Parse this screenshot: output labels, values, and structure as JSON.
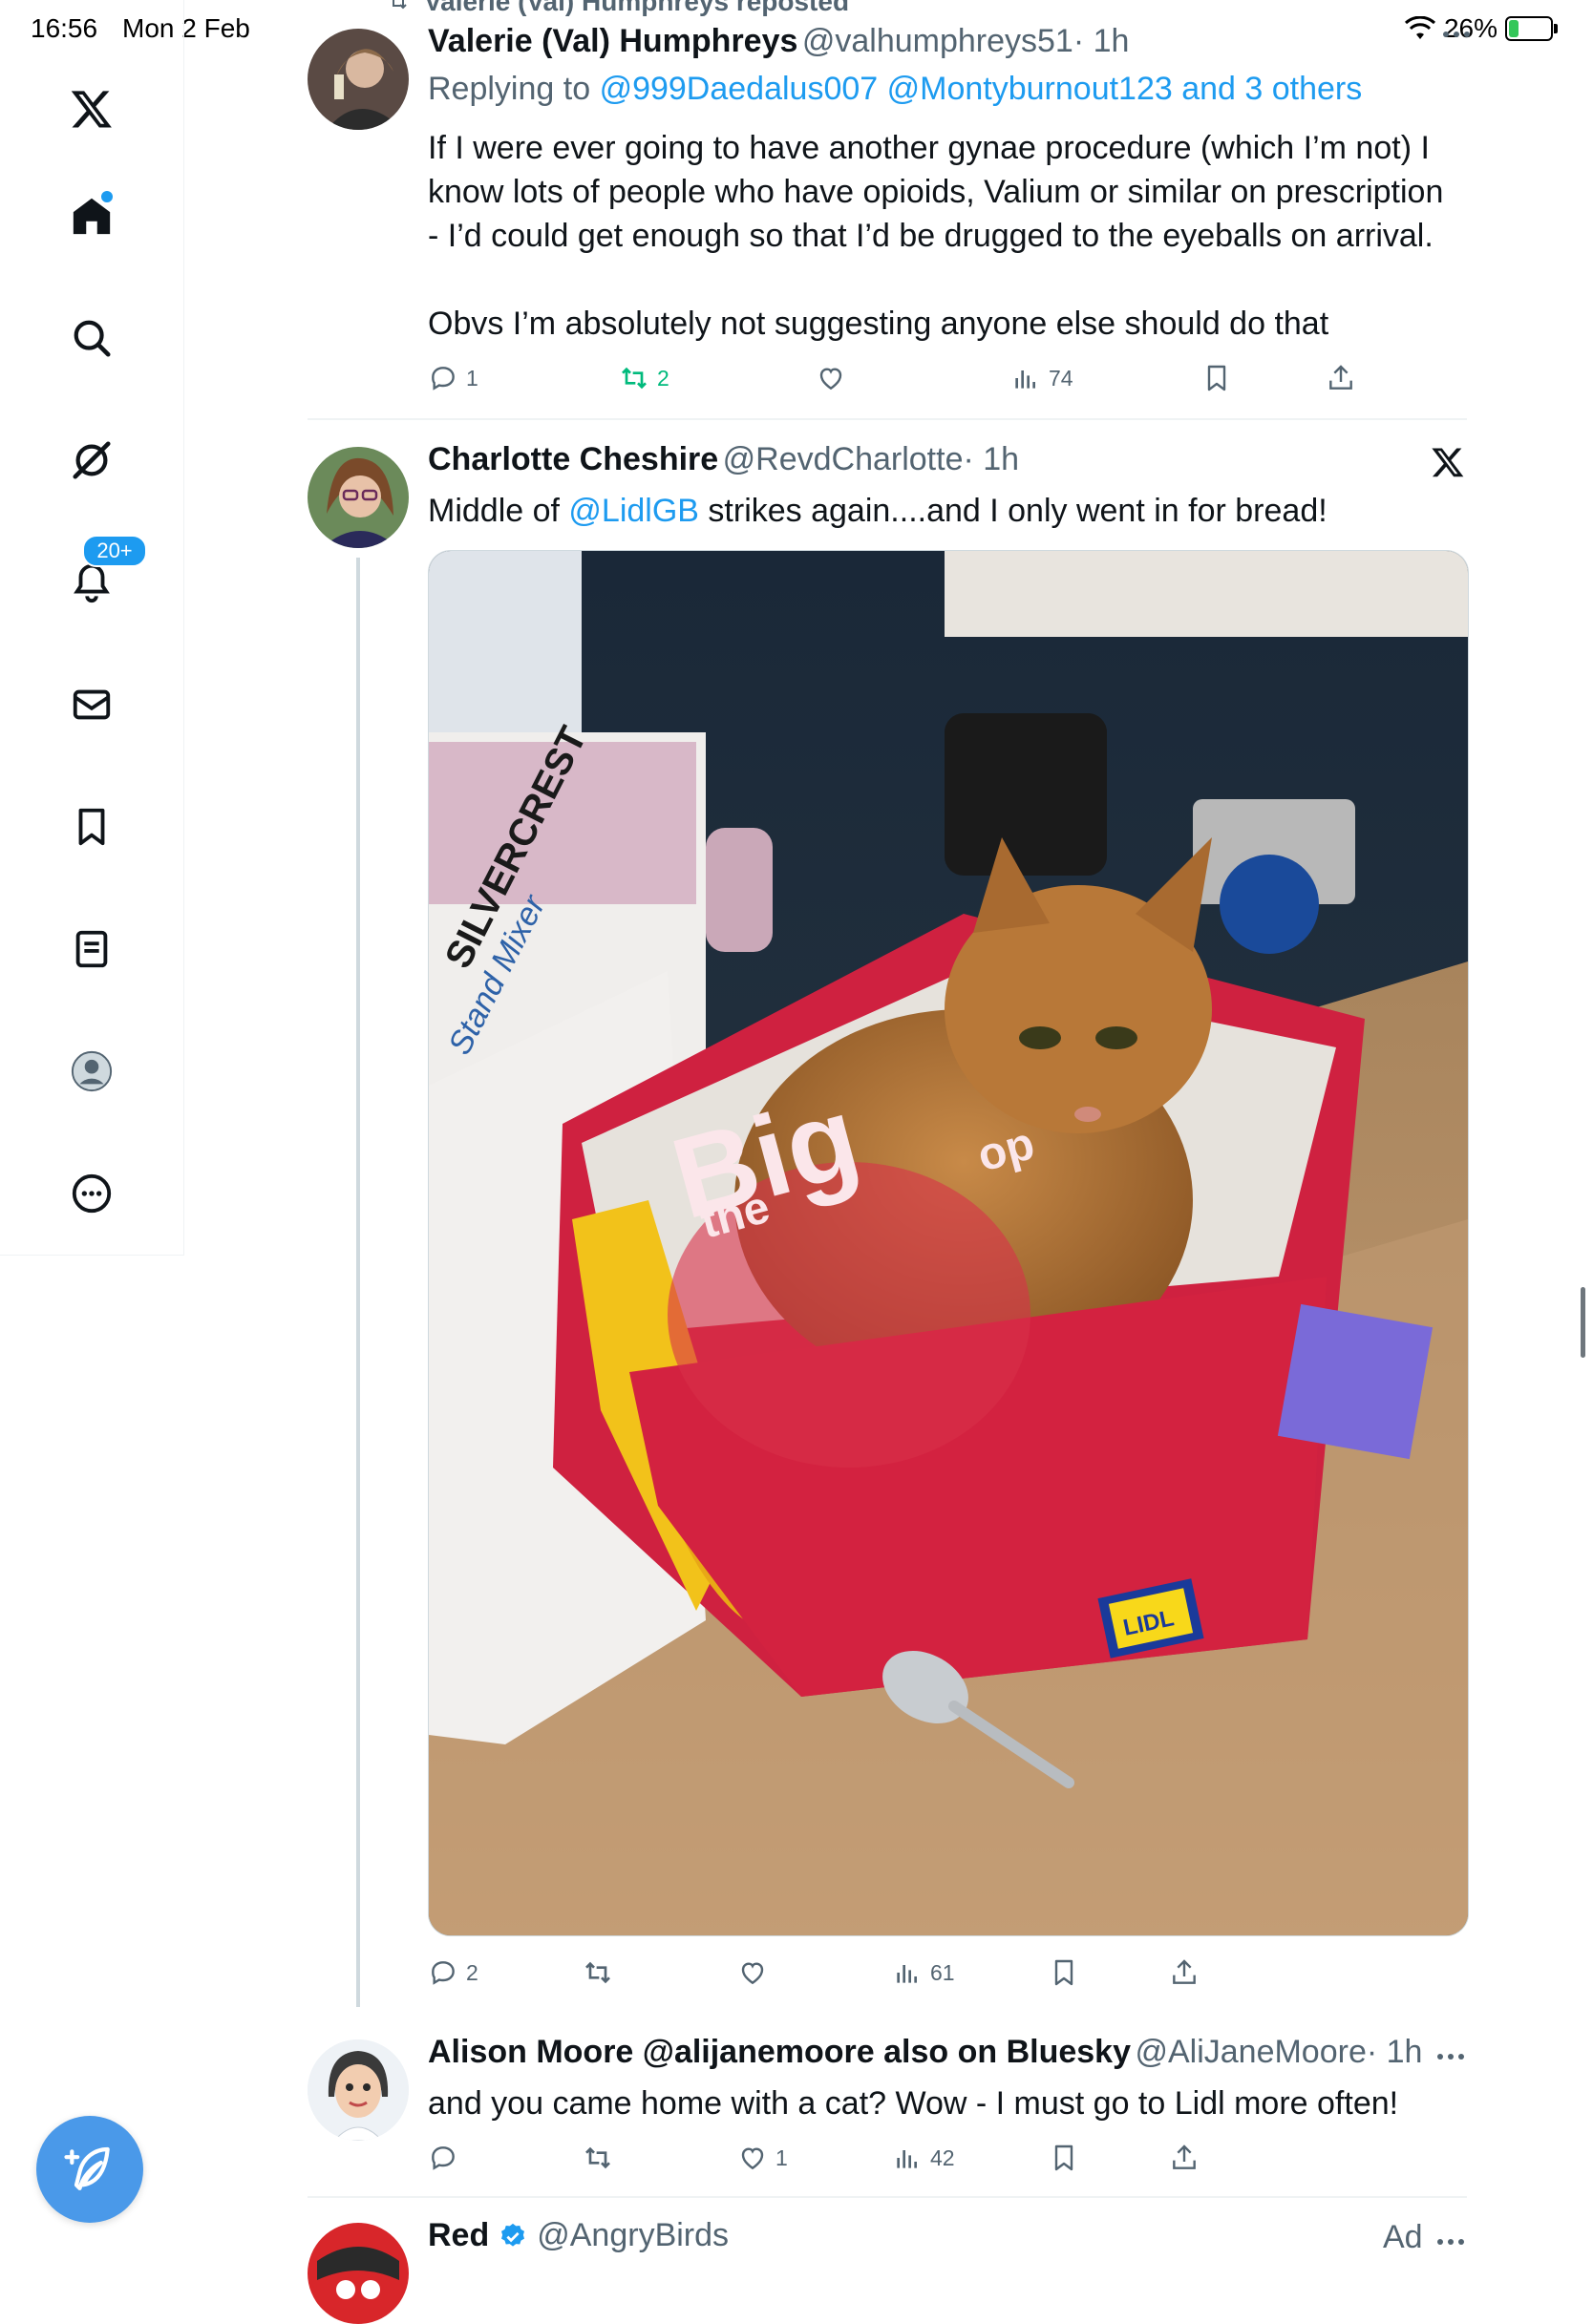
{
  "status_bar": {
    "time": "16:56",
    "date": "Mon 2 Feb",
    "battery": "26%",
    "battery_level": 0.26
  },
  "sidebar": {
    "notifications_badge": "20+",
    "items": [
      {
        "name": "x-logo-icon"
      },
      {
        "name": "home-icon"
      },
      {
        "name": "search-icon"
      },
      {
        "name": "grok-icon"
      },
      {
        "name": "notifications-icon"
      },
      {
        "name": "messages-icon"
      },
      {
        "name": "bookmarks-icon"
      },
      {
        "name": "lists-icon"
      },
      {
        "name": "profile-icon"
      },
      {
        "name": "more-icon"
      }
    ]
  },
  "tweets": [
    {
      "repost_label": "Valerie (Val) Humphreys reposted",
      "name": "Valerie (Val) Humphreys",
      "handle": "@valhumphreys51",
      "time": "· 1h",
      "replying_prefix": "Replying to",
      "replying_to": "@999Daedalus007 @Montyburnout123 and 3 others",
      "text_lines": [
        "If I were ever going to have another gynae procedure (which I’m not) I",
        "know lots of people who have opioids, Valium or similar on prescription",
        "- I’d could get enough so that I’d be drugged to the eyeballs on arrival."
      ],
      "text_line2": "Obvs I’m absolutely not suggesting anyone else should do that",
      "replies": "1",
      "reposts": "2",
      "likes": "",
      "views": "74"
    },
    {
      "name": "Charlotte Cheshire",
      "handle": "@RevdCharlotte",
      "time": "· 1h",
      "text_before": "Middle of ",
      "mention": "@LidlGB",
      "text_after": " strikes again....and I only went in for bread!",
      "image_texts": [
        "SILVERCREST",
        "Stand Mixer",
        "Big",
        "the",
        "op",
        "LIDL"
      ],
      "replies": "2",
      "reposts": "",
      "likes": "",
      "views": "61"
    },
    {
      "name": "Alison Moore @alijanemoore also on Bluesky",
      "handle": "@AliJaneMoore",
      "time": "· 1h",
      "text": "and you came home with a cat? Wow - I must go to Lidl more often!",
      "replies": "",
      "reposts": "",
      "likes": "1",
      "views": "42"
    },
    {
      "name": "Red",
      "handle": "@AngryBirds",
      "ad_label": "Ad"
    }
  ],
  "colors": {
    "accent": "#1d9bf0",
    "repost_green": "#00ba7c",
    "muted": "#536471",
    "bag_red": "#d8223f"
  }
}
